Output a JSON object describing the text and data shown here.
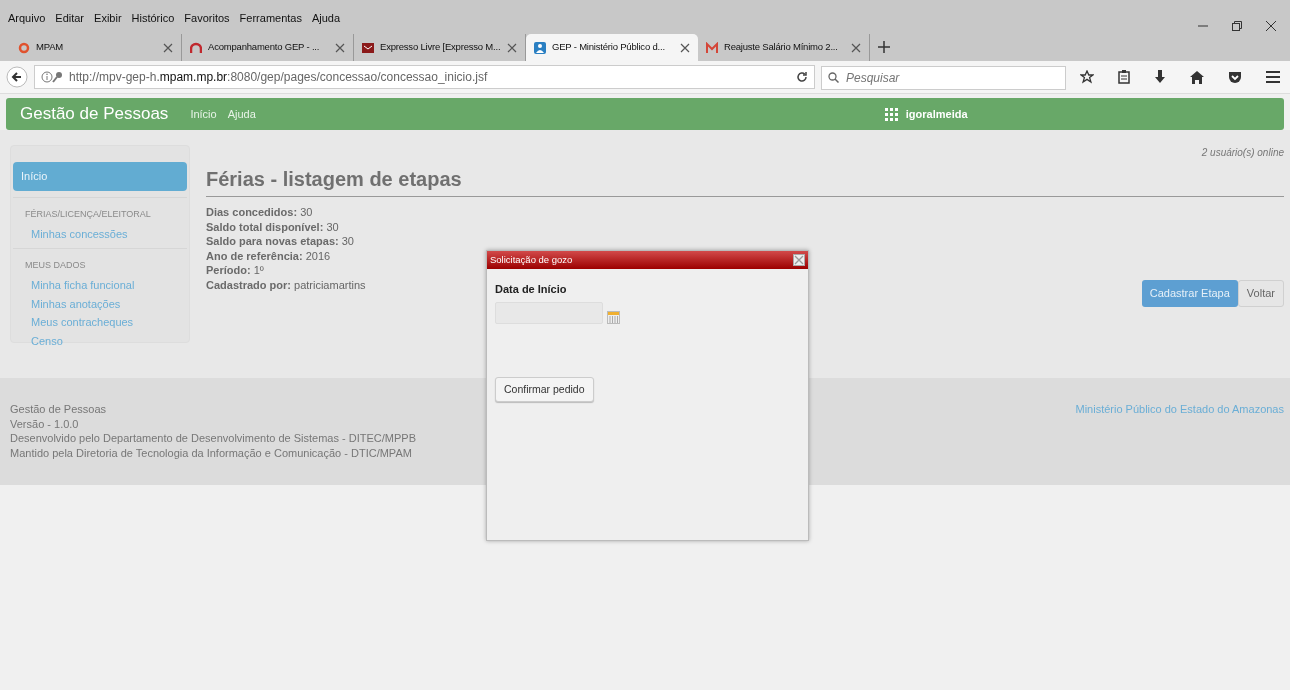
{
  "menu_bar": [
    "Arquivo",
    "Editar",
    "Exibir",
    "Histórico",
    "Favoritos",
    "Ferramentas",
    "Ajuda"
  ],
  "tabs": [
    {
      "label": "MPAM",
      "selected": false
    },
    {
      "label": "Acompanhamento GEP - ...",
      "selected": false
    },
    {
      "label": "Expresso Livre [Expresso M...",
      "selected": false
    },
    {
      "label": "GEP - Ministério Público d...",
      "selected": true
    },
    {
      "label": "Reajuste Salário Mínimo 2...",
      "selected": false
    }
  ],
  "address_bar": {
    "url": "http://mpv-gep-h.**mpam.mp.br**:8080/gep/pages/concessao/concessao_inicio.jsf"
  },
  "search": {
    "placeholder": "Pesquisar"
  },
  "navbar": {
    "brand": "Gestão de Pessoas",
    "links": [
      "Início",
      "Ajuda"
    ],
    "user": "igoralmeida"
  },
  "sidebar": {
    "items": [
      {
        "kind": "item",
        "label": "Início",
        "selected": true
      },
      {
        "kind": "header",
        "label": "FÉRIAS/LICENÇA/ELEITORAL"
      },
      {
        "kind": "item",
        "label": "Minhas concessões",
        "selected": false
      },
      {
        "kind": "header",
        "label": "MEUS DADOS"
      },
      {
        "kind": "item",
        "label": "Minha ficha funcional",
        "selected": false
      },
      {
        "kind": "item",
        "label": "Minhas anotações",
        "selected": false
      },
      {
        "kind": "item",
        "label": "Meus contracheques",
        "selected": false
      },
      {
        "kind": "item",
        "label": "Censo",
        "selected": false
      }
    ]
  },
  "online": "2 usuário(s) online",
  "title": "Férias - listagem de etapas",
  "details": [
    "**Dias concedidos:** 30",
    "**Saldo total disponível:** 30",
    "**Saldo para novas etapas:** 30",
    "**Ano de referência:** 2016",
    "**Período:** 1º",
    "**Cadastrado por:** patriciamartins"
  ],
  "actions": [
    {
      "label": "Cadastrar Etapa",
      "kind": "primary"
    },
    {
      "label": "Voltar",
      "kind": "secondary"
    }
  ],
  "footer": {
    "lines": [
      "Gestão de Pessoas",
      "Versão - 1.0.0",
      "Desenvolvido pelo Departamento de Desenvolvimento de Sistemas - DITEC/MPPB",
      "Mantido pela Diretoria de Tecnologia da Informação e Comunicação - DTIC/MPAM"
    ],
    "link": "Ministério Público do Estado do Amazonas"
  },
  "dialog": {
    "title": "Solicitação de gozo",
    "field_label": "Data de Início",
    "button": "Confirmar pedido"
  }
}
